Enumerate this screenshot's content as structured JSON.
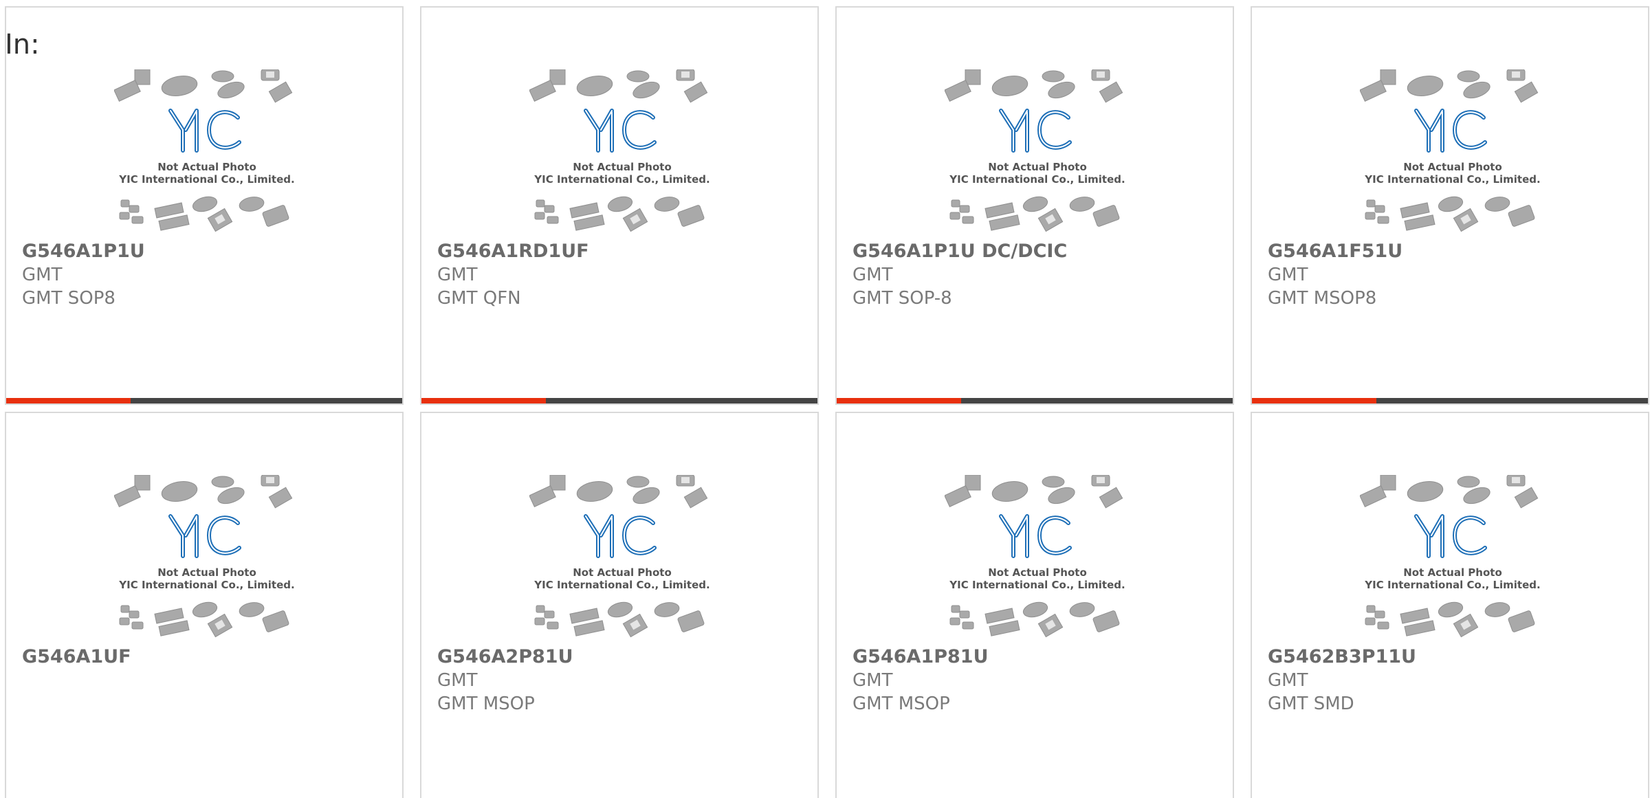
{
  "header": {
    "in_label": "In:"
  },
  "placeholder_image": {
    "line1": "Not Actual Photo",
    "line2": "YIC International Co., Limited.",
    "logo_text": "YIC",
    "logo_color": "#1e6fb7"
  },
  "colors": {
    "accent": "#e8300e",
    "bar_track": "#444444",
    "card_border": "#d9d9d9",
    "text": "#6a6a6a"
  },
  "products": [
    {
      "part_number": "G546A1P1U",
      "brand": "GMT",
      "package": "GMT SOP8",
      "bar_fraction": 0.315
    },
    {
      "part_number": "G546A1RD1UF",
      "brand": "GMT",
      "package": "GMT QFN",
      "bar_fraction": 0.315
    },
    {
      "part_number": "G546A1P1U DC/DCIC",
      "brand": "GMT",
      "package": "GMT SOP-8",
      "bar_fraction": 0.315
    },
    {
      "part_number": "G546A1F51U",
      "brand": "GMT",
      "package": "GMT MSOP8",
      "bar_fraction": 0.315
    },
    {
      "part_number": "G546A1UF",
      "brand": "",
      "package": ""
    },
    {
      "part_number": "G546A2P81U",
      "brand": "GMT",
      "package": "GMT MSOP"
    },
    {
      "part_number": "G546A1P81U",
      "brand": "GMT",
      "package": "GMT MSOP"
    },
    {
      "part_number": "G5462B3P11U",
      "brand": "GMT",
      "package": "GMT SMD"
    }
  ]
}
